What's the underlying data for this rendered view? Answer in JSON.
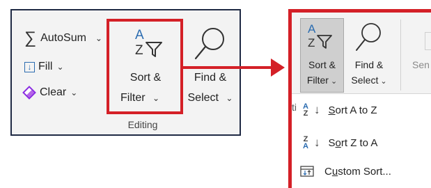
{
  "left": {
    "autosum_label": "AutoSum",
    "fill_label": "Fill",
    "clear_label": "Clear",
    "sort_filter_line1": "Sort &",
    "sort_filter_line2": "Filter",
    "find_select_line1": "Find &",
    "find_select_line2": "Select",
    "group_label": "Editing"
  },
  "right": {
    "sort_filter_line1": "Sort &",
    "sort_filter_line2": "Filter",
    "find_select_line1": "Find &",
    "find_select_line2": "Select",
    "partial_label": "Sen",
    "partial_row_char": "ti",
    "menu": {
      "sort_az": {
        "underlined": "S",
        "rest": "ort A to Z"
      },
      "sort_za": {
        "pre": "S",
        "underlined": "o",
        "rest": "rt Z to A"
      },
      "custom_sort": {
        "pre": "C",
        "underlined": "u",
        "rest": "stom Sort..."
      }
    }
  },
  "glyphs": {
    "chevron": "⌄",
    "sigma": "∑",
    "down_arrow": "↓",
    "letter_a": "A",
    "letter_z": "Z"
  },
  "colors": {
    "highlight_red": "#d42027",
    "ribbon_bg": "#f3f3f3",
    "selected_bg": "#cfcfcf",
    "icon_blue": "#2b6cb0"
  }
}
